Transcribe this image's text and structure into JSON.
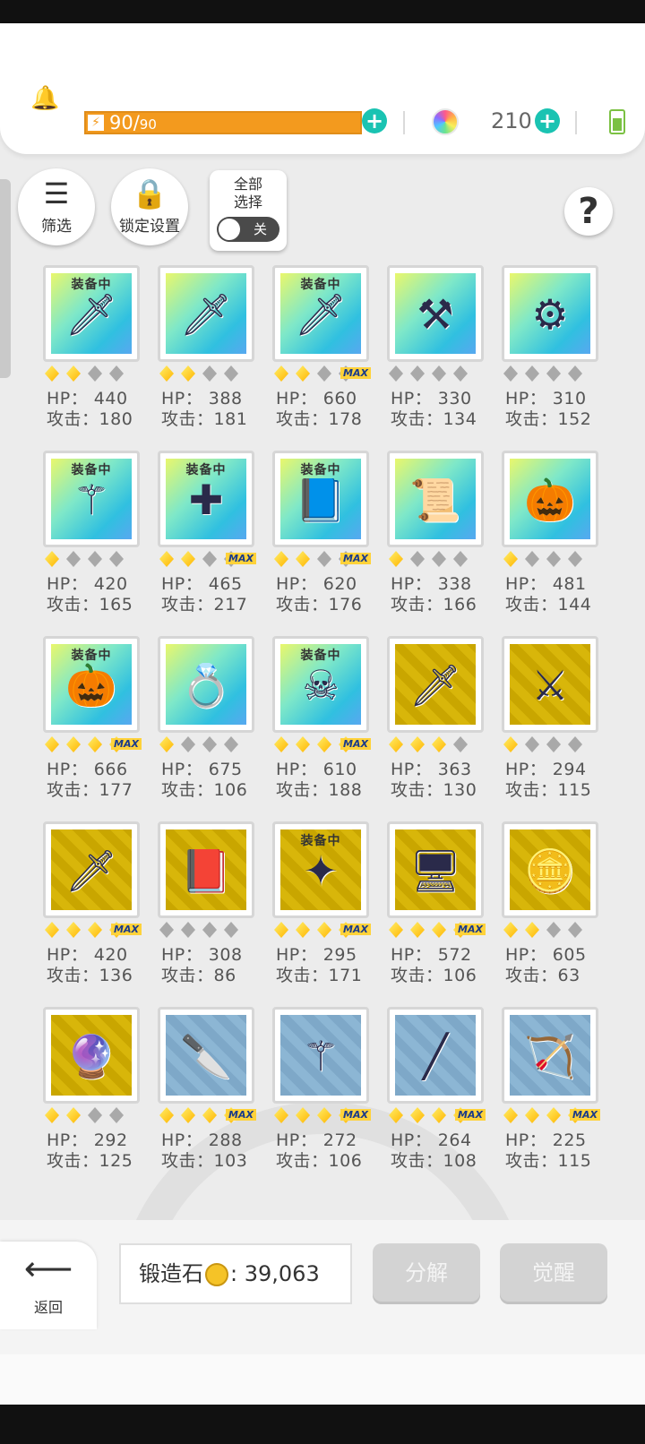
{
  "header": {
    "energy_current": "90/",
    "energy_max": "90",
    "energy_fraction": 1.0,
    "gems": "210"
  },
  "toolbar": {
    "filter_label": "筛选",
    "lock_label": "锁定设置",
    "select_all_label_1": "全部",
    "select_all_label_2": "选择",
    "toggle_label": "关",
    "help_label": "?"
  },
  "stat_labels": {
    "hp": "HP：",
    "atk": "攻击："
  },
  "equip_tag": "装备中",
  "max_tag": "MAX",
  "items": [
    {
      "icon": "sword-icon",
      "glyph": "🗡",
      "bg": "teal",
      "equipped": true,
      "stars": 2,
      "max": false,
      "hp": "440",
      "atk": "180"
    },
    {
      "icon": "dagger-icon",
      "glyph": "🗡",
      "bg": "teal",
      "equipped": false,
      "stars": 2,
      "max": false,
      "hp": "388",
      "atk": "181"
    },
    {
      "icon": "sword-icon",
      "glyph": "🗡",
      "bg": "teal",
      "equipped": true,
      "stars": 2,
      "max": true,
      "hp": "660",
      "atk": "178"
    },
    {
      "icon": "axe-icon",
      "glyph": "⚒",
      "bg": "teal",
      "equipped": false,
      "stars": 0,
      "max": false,
      "hp": "330",
      "atk": "134"
    },
    {
      "icon": "flail-icon",
      "glyph": "⚙",
      "bg": "teal",
      "equipped": false,
      "stars": 0,
      "max": false,
      "hp": "310",
      "atk": "152"
    },
    {
      "icon": "staff-icon",
      "glyph": "⚚",
      "bg": "teal",
      "equipped": true,
      "stars": 1,
      "max": false,
      "hp": "420",
      "atk": "165"
    },
    {
      "icon": "mace-icon",
      "glyph": "✚",
      "bg": "teal",
      "equipped": true,
      "stars": 2,
      "max": true,
      "hp": "465",
      "atk": "217"
    },
    {
      "icon": "spellbook-icon",
      "glyph": "📘",
      "bg": "teal",
      "equipped": true,
      "stars": 2,
      "max": true,
      "hp": "620",
      "atk": "176"
    },
    {
      "icon": "scroll-icon",
      "glyph": "📜",
      "bg": "teal",
      "equipped": false,
      "stars": 1,
      "max": false,
      "hp": "338",
      "atk": "166"
    },
    {
      "icon": "pumpkin-staff-icon",
      "glyph": "🎃",
      "bg": "teal",
      "equipped": false,
      "stars": 1,
      "max": false,
      "hp": "481",
      "atk": "144"
    },
    {
      "icon": "pumpkin-icon",
      "glyph": "🎃",
      "bg": "teal",
      "equipped": true,
      "stars": 4,
      "max": true,
      "hp": "666",
      "atk": "177"
    },
    {
      "icon": "ring-icon",
      "glyph": "💍",
      "bg": "teal",
      "equipped": false,
      "stars": 1,
      "max": false,
      "hp": "675",
      "atk": "106"
    },
    {
      "icon": "skull-mask-icon",
      "glyph": "☠",
      "bg": "teal",
      "equipped": true,
      "stars": 4,
      "max": true,
      "hp": "610",
      "atk": "188"
    },
    {
      "icon": "greatsword-icon",
      "glyph": "🗡",
      "bg": "gold",
      "equipped": false,
      "stars": 3,
      "max": false,
      "hp": "363",
      "atk": "130"
    },
    {
      "icon": "lightsaber-icon",
      "glyph": "⚔",
      "bg": "gold",
      "equipped": false,
      "stars": 1,
      "max": false,
      "hp": "294",
      "atk": "115"
    },
    {
      "icon": "sword-icon",
      "glyph": "🗡",
      "bg": "gold",
      "equipped": false,
      "stars": 4,
      "max": true,
      "hp": "420",
      "atk": "136"
    },
    {
      "icon": "pumpkin-book-icon",
      "glyph": "📕",
      "bg": "gold",
      "equipped": false,
      "stars": 0,
      "max": false,
      "hp": "308",
      "atk": "86"
    },
    {
      "icon": "golden-scepter-icon",
      "glyph": "✦",
      "bg": "gold",
      "equipped": true,
      "stars": 4,
      "max": true,
      "hp": "295",
      "atk": "171"
    },
    {
      "icon": "computer-icon",
      "glyph": "🖥",
      "bg": "gold",
      "equipped": false,
      "stars": 4,
      "max": true,
      "hp": "572",
      "atk": "106"
    },
    {
      "icon": "coin-amulet-icon",
      "glyph": "🪙",
      "bg": "gold",
      "equipped": false,
      "stars": 2,
      "max": false,
      "hp": "605",
      "atk": "63"
    },
    {
      "icon": "orb-icon",
      "glyph": "🔮",
      "bg": "gold",
      "equipped": false,
      "stars": 2,
      "max": false,
      "hp": "292",
      "atk": "125"
    },
    {
      "icon": "knife-icon",
      "glyph": "🔪",
      "bg": "blue",
      "equipped": false,
      "stars": 4,
      "max": true,
      "hp": "288",
      "atk": "103"
    },
    {
      "icon": "scythe-icon",
      "glyph": "⚚",
      "bg": "blue",
      "equipped": false,
      "stars": 4,
      "max": true,
      "hp": "272",
      "atk": "106"
    },
    {
      "icon": "spear-icon",
      "glyph": "╱",
      "bg": "blue",
      "equipped": false,
      "stars": 4,
      "max": true,
      "hp": "264",
      "atk": "108"
    },
    {
      "icon": "crossbow-icon",
      "glyph": "🏹",
      "bg": "blue",
      "equipped": false,
      "stars": 4,
      "max": true,
      "hp": "225",
      "atk": "115"
    }
  ],
  "footer": {
    "back_label": "返回",
    "forge_label": "锻造石",
    "forge_sep": ":",
    "forge_value": "39,063",
    "decompose_label": "分解",
    "awaken_label": "觉醒"
  }
}
